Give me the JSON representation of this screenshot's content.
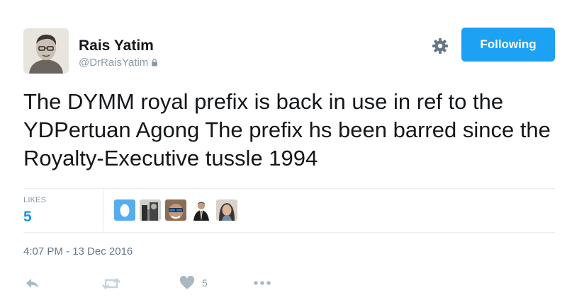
{
  "author": {
    "name": "Rais Yatim",
    "handle": "@DrRaisYatim"
  },
  "follow_button": {
    "label": "Following"
  },
  "tweet": {
    "text": "The DYMM royal prefix is back in use in ref to the YDPertuan Agong The prefix hs been barred since the Royalty-Executive tussle 1994",
    "timestamp": "4:07 PM - 13 Dec 2016"
  },
  "stats": {
    "likes_label": "LIKES",
    "likes_count": "5"
  },
  "actions": {
    "like_count": "5"
  },
  "icons": [
    "lock-icon",
    "gear-icon",
    "reply-icon",
    "retweet-icon",
    "heart-icon",
    "more-icon"
  ],
  "colors": {
    "accent": "#1da1f2",
    "muted": "#8899a6",
    "count": "#1b95e0"
  }
}
